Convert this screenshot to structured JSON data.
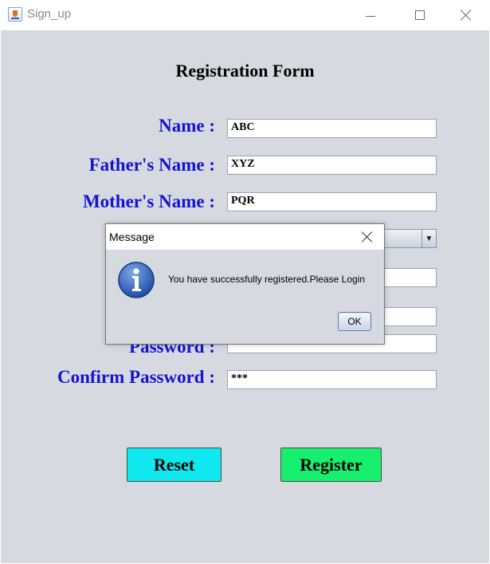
{
  "window": {
    "title": "Sign_up",
    "icon": "java-coffee-icon"
  },
  "form": {
    "title": "Registration Form",
    "fields": [
      {
        "label": "Name :",
        "value": "ABC"
      },
      {
        "label": "Father's Name :",
        "value": "XYZ"
      },
      {
        "label": "Mother's Name :",
        "value": "PQR"
      },
      {
        "label": "",
        "value": ""
      },
      {
        "label": "",
        "value": ""
      },
      {
        "label": "",
        "value": ""
      },
      {
        "label": "Password :",
        "value": ""
      },
      {
        "label": "Confirm Password :",
        "value": "***"
      }
    ],
    "buttons": {
      "reset": "Reset",
      "register": "Register"
    },
    "colors": {
      "label": "#1414d4",
      "background": "#d6d9e0",
      "reset_button": "#0ee8ee",
      "register_button": "#17f06f"
    }
  },
  "dialog": {
    "title": "Message",
    "message": "You have successfully registered.Please Login",
    "ok_label": "OK",
    "icon": "info-icon"
  }
}
